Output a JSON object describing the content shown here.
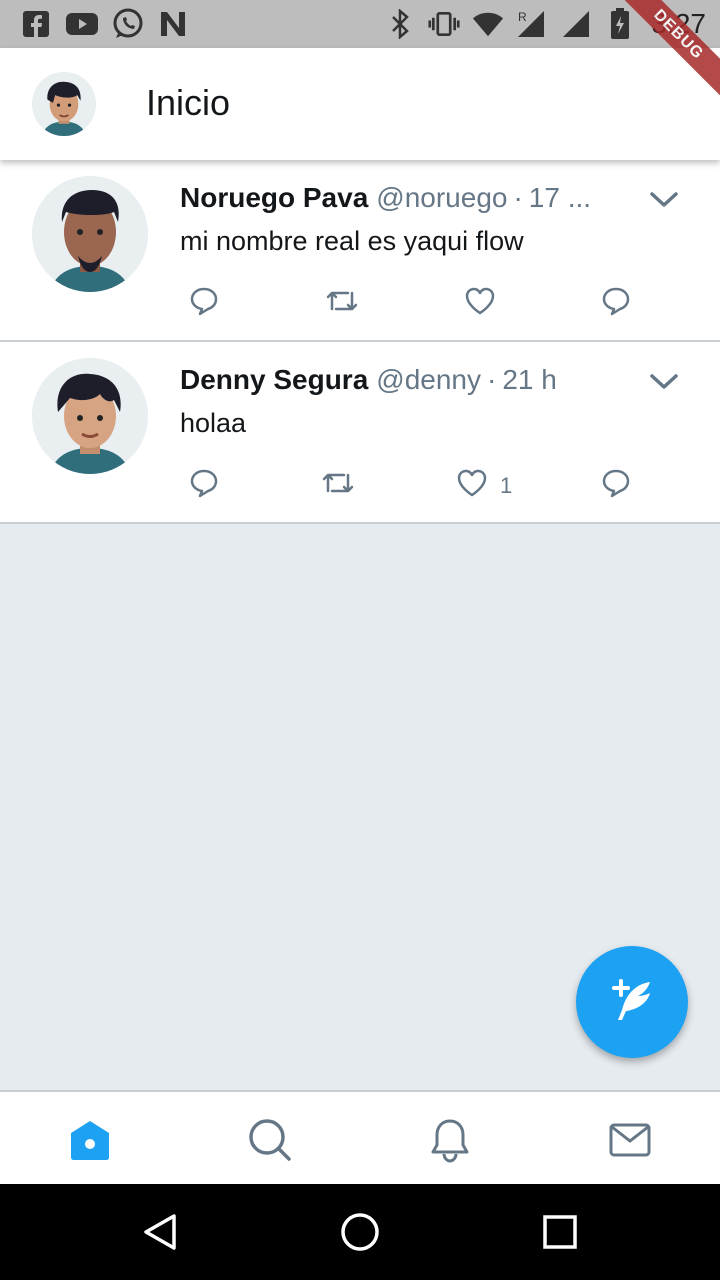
{
  "status_bar": {
    "time": "3:27",
    "left_icons": [
      "facebook-icon",
      "youtube-icon",
      "whatsapp-icon",
      "n-app-icon"
    ],
    "right_icons": [
      "bluetooth-icon",
      "vibrate-icon",
      "wifi-icon",
      "signal-roaming-icon",
      "signal-icon",
      "battery-icon"
    ]
  },
  "debug_banner": "DEBUG",
  "app_bar": {
    "title": "Inicio"
  },
  "tweets": [
    {
      "name": "Noruego Pava",
      "handle": "@noruego",
      "separator": "·",
      "time": "17 ...",
      "text": "mi nombre real es yaqui flow",
      "like_count": ""
    },
    {
      "name": "Denny Segura",
      "handle": "@denny",
      "separator": "·",
      "time": "21 h",
      "text": "holaa",
      "like_count": "1"
    }
  ],
  "bottom_nav": [
    "home-icon",
    "search-icon",
    "notifications-icon",
    "messages-icon"
  ],
  "colors": {
    "accent": "#1da1f2",
    "text": "#14171a",
    "muted": "#657786",
    "background": "#e6ebf0"
  }
}
